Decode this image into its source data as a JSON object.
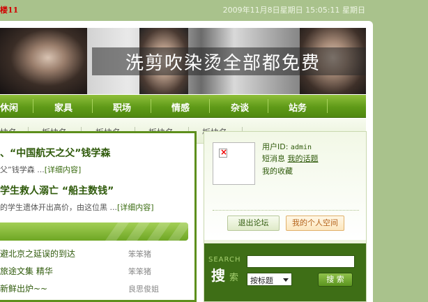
{
  "topbar": {
    "left_text": "楼11",
    "datetime": "2009年11月8日星期日 15:05:11 星期日"
  },
  "banner": {
    "slogan": "洗剪吹染烫全部都免费"
  },
  "nav": {
    "items": [
      "休闲",
      "家具",
      "职场",
      "情感",
      "杂谈",
      "站务"
    ]
  },
  "subnav": {
    "items": [
      "块名",
      "板块名",
      "板块名",
      "板块名",
      "板块名"
    ]
  },
  "news": {
    "headline1": "、“中国航天之父”钱学森",
    "sub1": "父”钱学森 ...",
    "sub1_more": "[详细内容]",
    "headline2": "学生救人溺亡 “船主数钱”",
    "sub2": "的学生遗体开出高价，由这位黑 ...",
    "sub2_more": "[详细内容]"
  },
  "list": [
    {
      "title": "避北京之延误的到达",
      "author": "笨笨猪"
    },
    {
      "title": "旅途文集 精华",
      "author": "笨笨猪"
    },
    {
      "title": "新鲜出炉~~",
      "author": "良思俊姐"
    },
    {
      "title": "",
      "author": ""
    }
  ],
  "user": {
    "id_label": "用户ID:",
    "id_value": "admin",
    "msg_label": "短消息",
    "msg_link": "我的话题",
    "fav": "我的收藏",
    "logout_label": "退出论坛",
    "space_label": "我的个人空间"
  },
  "search": {
    "en_label": "SEARCH",
    "cn_label_1": "搜",
    "cn_label_2": "索",
    "input_value": "",
    "select_value": "按标题",
    "button_label": "搜 索"
  }
}
